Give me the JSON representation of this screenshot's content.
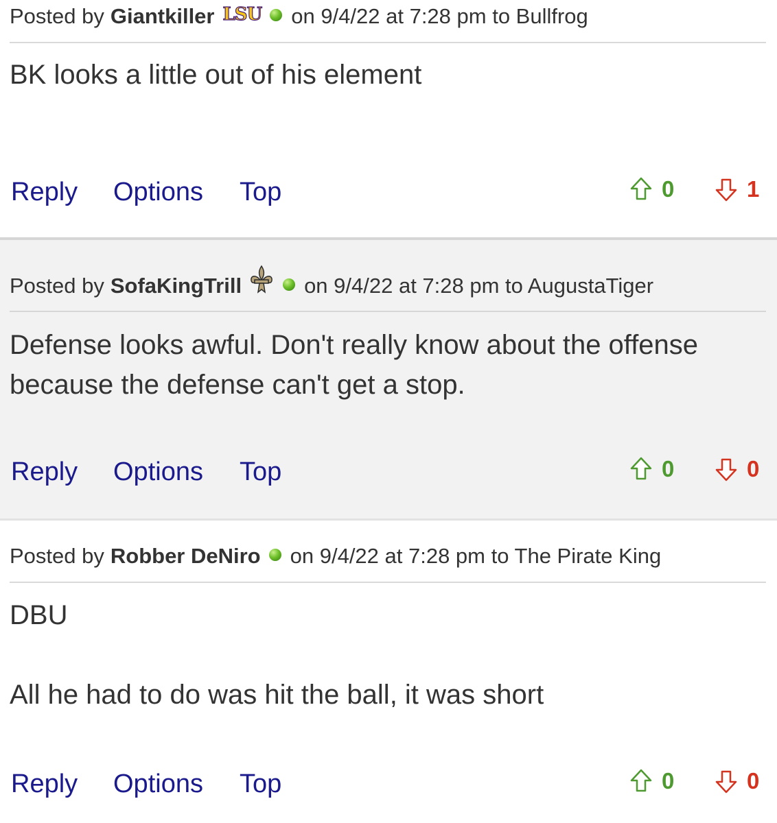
{
  "posts": [
    {
      "posted_by_label": "Posted by",
      "author": "Giantkiller",
      "badge_text": "LSU",
      "meta": "on 9/4/22 at 7:28 pm to Bullfrog",
      "body": "BK looks a little out of his element",
      "actions": {
        "reply": "Reply",
        "options": "Options",
        "top": "Top"
      },
      "upvotes": "0",
      "downvotes": "1"
    },
    {
      "posted_by_label": "Posted by",
      "author": "SofaKingTrill",
      "meta": "on 9/4/22 at 7:28 pm to AugustaTiger",
      "body": "Defense looks awful. Don't really know about the offense because the defense can't get a stop.",
      "actions": {
        "reply": "Reply",
        "options": "Options",
        "top": "Top"
      },
      "upvotes": "0",
      "downvotes": "0"
    },
    {
      "posted_by_label": "Posted by",
      "author": "Robber DeNiro",
      "meta": "on 9/4/22 at 7:28 pm to The Pirate King",
      "body": "DBU\n\nAll he had to do was hit the ball, it was short",
      "actions": {
        "reply": "Reply",
        "options": "Options",
        "top": "Top"
      },
      "upvotes": "0",
      "downvotes": "0"
    }
  ],
  "colors": {
    "link": "#1a1a8c",
    "upvote": "#4e9a31",
    "downvote": "#d4341f",
    "alt_background": "#f2f2f2"
  },
  "icons": {
    "online": "online-status-dot-icon",
    "team_lsu": "lsu-logo-icon",
    "team_saints": "fleur-de-lis-icon",
    "upvote": "thumb-up-arrow-icon",
    "downvote": "thumb-down-arrow-icon"
  }
}
